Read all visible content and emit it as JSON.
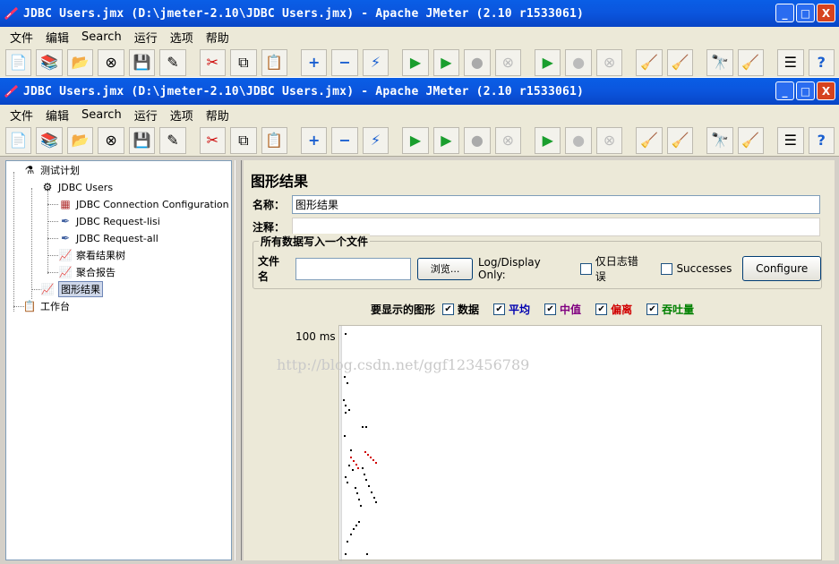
{
  "window": {
    "title": "JDBC Users.jmx (D:\\jmeter-2.10\\JDBC Users.jmx) - Apache JMeter (2.10 r1533061)",
    "controls": {
      "minimize": "_",
      "maximize": "□",
      "close": "X"
    }
  },
  "menu": [
    "文件",
    "编辑",
    "Search",
    "运行",
    "选项",
    "帮助"
  ],
  "toolbar_icons": [
    "new-icon",
    "templates-icon",
    "open-icon",
    "close-file-icon",
    "save-icon",
    "save-as-icon",
    "cut-icon",
    "copy-icon",
    "paste-icon",
    "expand-icon",
    "collapse-icon",
    "toggle-icon",
    "start-icon",
    "start-no-pause-icon",
    "stop-icon",
    "shutdown-icon",
    "remote-start-icon",
    "remote-stop-icon",
    "remote-shutdown-icon",
    "clear-icon",
    "clear-all-icon",
    "search-icon",
    "reset-search-icon",
    "function-helper-icon",
    "help-icon"
  ],
  "tree": {
    "test_plan": "测试计划",
    "thread_group": "JDBC Users",
    "items": [
      "JDBC Connection Configuration",
      "JDBC Request-lisi",
      "JDBC Request-all",
      "察看结果树",
      "聚合报告"
    ],
    "selected": "图形结果",
    "workbench": "工作台"
  },
  "panel": {
    "title": "图形结果",
    "name_label": "名称：",
    "name_value": "图形结果",
    "comment_label": "注释：",
    "comment_value": "",
    "file_group_title": "所有数据写入一个文件",
    "filename_label": "文件名",
    "filename_value": "",
    "browse_button": "浏览...",
    "log_display_label": "Log/Display Only:",
    "errors_label": "仅日志错误",
    "successes_label": "Successes",
    "configure_button": "Configure",
    "graphs_label": "要显示的图形",
    "checks": [
      {
        "label": "数据",
        "color": "#000000"
      },
      {
        "label": "平均",
        "color": "#0000b0"
      },
      {
        "label": "中值",
        "color": "#800080"
      },
      {
        "label": "偏离",
        "color": "#d00000"
      },
      {
        "label": "吞吐量",
        "color": "#008000"
      }
    ]
  },
  "chart": {
    "y_label": "100 ms",
    "watermark": "http://blog.csdn.net/ggf123456789"
  }
}
